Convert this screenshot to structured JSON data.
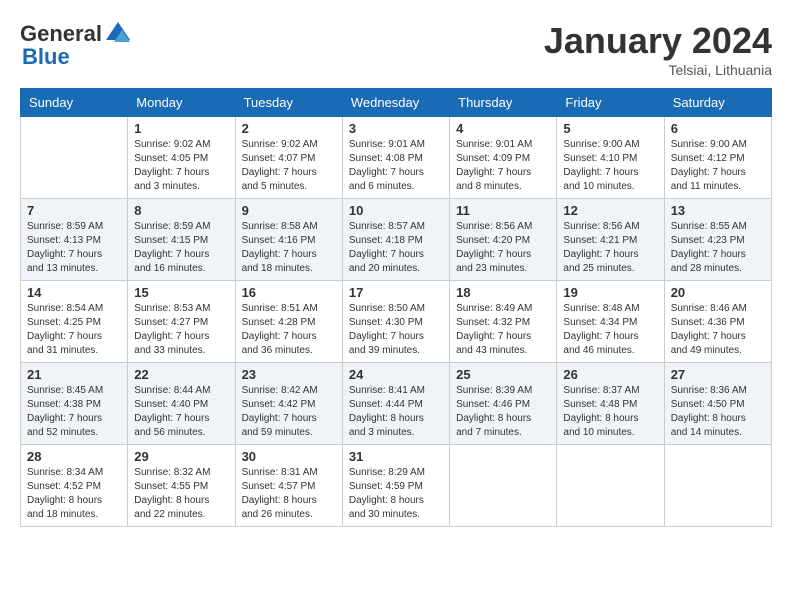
{
  "header": {
    "logo_general": "General",
    "logo_blue": "Blue",
    "month_title": "January 2024",
    "location": "Telsiai, Lithuania"
  },
  "calendar": {
    "days_of_week": [
      "Sunday",
      "Monday",
      "Tuesday",
      "Wednesday",
      "Thursday",
      "Friday",
      "Saturday"
    ],
    "weeks": [
      [
        {
          "number": "",
          "info": ""
        },
        {
          "number": "1",
          "info": "Sunrise: 9:02 AM\nSunset: 4:05 PM\nDaylight: 7 hours\nand 3 minutes."
        },
        {
          "number": "2",
          "info": "Sunrise: 9:02 AM\nSunset: 4:07 PM\nDaylight: 7 hours\nand 5 minutes."
        },
        {
          "number": "3",
          "info": "Sunrise: 9:01 AM\nSunset: 4:08 PM\nDaylight: 7 hours\nand 6 minutes."
        },
        {
          "number": "4",
          "info": "Sunrise: 9:01 AM\nSunset: 4:09 PM\nDaylight: 7 hours\nand 8 minutes."
        },
        {
          "number": "5",
          "info": "Sunrise: 9:00 AM\nSunset: 4:10 PM\nDaylight: 7 hours\nand 10 minutes."
        },
        {
          "number": "6",
          "info": "Sunrise: 9:00 AM\nSunset: 4:12 PM\nDaylight: 7 hours\nand 11 minutes."
        }
      ],
      [
        {
          "number": "7",
          "info": "Sunrise: 8:59 AM\nSunset: 4:13 PM\nDaylight: 7 hours\nand 13 minutes."
        },
        {
          "number": "8",
          "info": "Sunrise: 8:59 AM\nSunset: 4:15 PM\nDaylight: 7 hours\nand 16 minutes."
        },
        {
          "number": "9",
          "info": "Sunrise: 8:58 AM\nSunset: 4:16 PM\nDaylight: 7 hours\nand 18 minutes."
        },
        {
          "number": "10",
          "info": "Sunrise: 8:57 AM\nSunset: 4:18 PM\nDaylight: 7 hours\nand 20 minutes."
        },
        {
          "number": "11",
          "info": "Sunrise: 8:56 AM\nSunset: 4:20 PM\nDaylight: 7 hours\nand 23 minutes."
        },
        {
          "number": "12",
          "info": "Sunrise: 8:56 AM\nSunset: 4:21 PM\nDaylight: 7 hours\nand 25 minutes."
        },
        {
          "number": "13",
          "info": "Sunrise: 8:55 AM\nSunset: 4:23 PM\nDaylight: 7 hours\nand 28 minutes."
        }
      ],
      [
        {
          "number": "14",
          "info": "Sunrise: 8:54 AM\nSunset: 4:25 PM\nDaylight: 7 hours\nand 31 minutes."
        },
        {
          "number": "15",
          "info": "Sunrise: 8:53 AM\nSunset: 4:27 PM\nDaylight: 7 hours\nand 33 minutes."
        },
        {
          "number": "16",
          "info": "Sunrise: 8:51 AM\nSunset: 4:28 PM\nDaylight: 7 hours\nand 36 minutes."
        },
        {
          "number": "17",
          "info": "Sunrise: 8:50 AM\nSunset: 4:30 PM\nDaylight: 7 hours\nand 39 minutes."
        },
        {
          "number": "18",
          "info": "Sunrise: 8:49 AM\nSunset: 4:32 PM\nDaylight: 7 hours\nand 43 minutes."
        },
        {
          "number": "19",
          "info": "Sunrise: 8:48 AM\nSunset: 4:34 PM\nDaylight: 7 hours\nand 46 minutes."
        },
        {
          "number": "20",
          "info": "Sunrise: 8:46 AM\nSunset: 4:36 PM\nDaylight: 7 hours\nand 49 minutes."
        }
      ],
      [
        {
          "number": "21",
          "info": "Sunrise: 8:45 AM\nSunset: 4:38 PM\nDaylight: 7 hours\nand 52 minutes."
        },
        {
          "number": "22",
          "info": "Sunrise: 8:44 AM\nSunset: 4:40 PM\nDaylight: 7 hours\nand 56 minutes."
        },
        {
          "number": "23",
          "info": "Sunrise: 8:42 AM\nSunset: 4:42 PM\nDaylight: 7 hours\nand 59 minutes."
        },
        {
          "number": "24",
          "info": "Sunrise: 8:41 AM\nSunset: 4:44 PM\nDaylight: 8 hours\nand 3 minutes."
        },
        {
          "number": "25",
          "info": "Sunrise: 8:39 AM\nSunset: 4:46 PM\nDaylight: 8 hours\nand 7 minutes."
        },
        {
          "number": "26",
          "info": "Sunrise: 8:37 AM\nSunset: 4:48 PM\nDaylight: 8 hours\nand 10 minutes."
        },
        {
          "number": "27",
          "info": "Sunrise: 8:36 AM\nSunset: 4:50 PM\nDaylight: 8 hours\nand 14 minutes."
        }
      ],
      [
        {
          "number": "28",
          "info": "Sunrise: 8:34 AM\nSunset: 4:52 PM\nDaylight: 8 hours\nand 18 minutes."
        },
        {
          "number": "29",
          "info": "Sunrise: 8:32 AM\nSunset: 4:55 PM\nDaylight: 8 hours\nand 22 minutes."
        },
        {
          "number": "30",
          "info": "Sunrise: 8:31 AM\nSunset: 4:57 PM\nDaylight: 8 hours\nand 26 minutes."
        },
        {
          "number": "31",
          "info": "Sunrise: 8:29 AM\nSunset: 4:59 PM\nDaylight: 8 hours\nand 30 minutes."
        },
        {
          "number": "",
          "info": ""
        },
        {
          "number": "",
          "info": ""
        },
        {
          "number": "",
          "info": ""
        }
      ]
    ]
  }
}
